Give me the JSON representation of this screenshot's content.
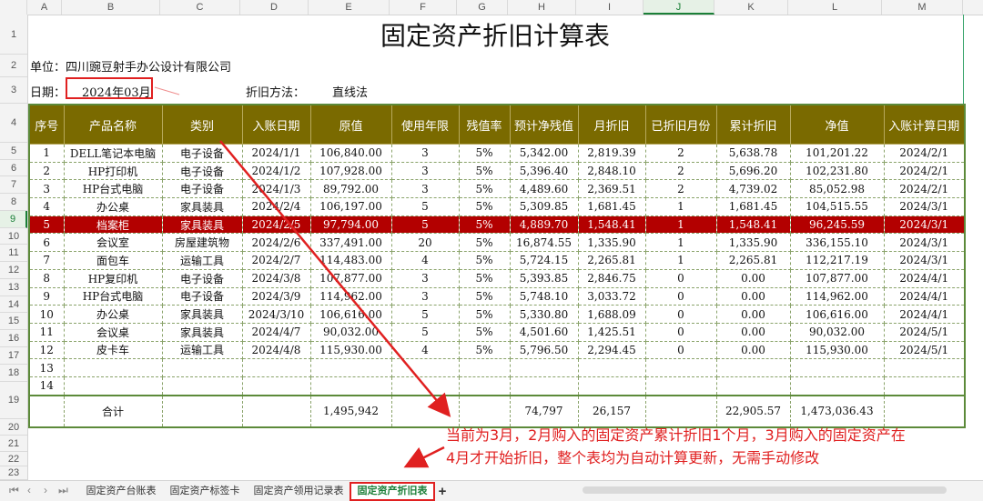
{
  "columns": [
    "A",
    "B",
    "C",
    "D",
    "E",
    "F",
    "G",
    "H",
    "I",
    "J",
    "K",
    "L",
    "M"
  ],
  "selected_column": "J",
  "row_numbers": [
    "1",
    "2",
    "3",
    "4",
    "5",
    "6",
    "7",
    "8",
    "9",
    "10",
    "11",
    "12",
    "13",
    "14",
    "15",
    "16",
    "17",
    "18",
    "19",
    "20",
    "21",
    "22",
    "23"
  ],
  "selected_row": "9",
  "title": "固定资产折旧计算表",
  "unit_label": "单位：四川豌豆射手办公设计有限公司",
  "date_label": "日期：",
  "date_value": "2024年03月",
  "method_label": "折旧方法：",
  "method_value": "直线法",
  "headers": [
    "序号",
    "产品名称",
    "类别",
    "入账日期",
    "原值",
    "使用年限",
    "残值率",
    "预计净残值",
    "月折旧",
    "已折旧月份",
    "累计折旧",
    "净值",
    "入账计算日期"
  ],
  "rows": [
    [
      "1",
      "DELL笔记本电脑",
      "电子设备",
      "2024/1/1",
      "106,840.00",
      "3",
      "5%",
      "5,342.00",
      "2,819.39",
      "2",
      "5,638.78",
      "101,201.22",
      "2024/2/1"
    ],
    [
      "2",
      "HP打印机",
      "电子设备",
      "2024/1/2",
      "107,928.00",
      "3",
      "5%",
      "5,396.40",
      "2,848.10",
      "2",
      "5,696.20",
      "102,231.80",
      "2024/2/1"
    ],
    [
      "3",
      "HP台式电脑",
      "电子设备",
      "2024/1/3",
      "89,792.00",
      "3",
      "5%",
      "4,489.60",
      "2,369.51",
      "2",
      "4,739.02",
      "85,052.98",
      "2024/2/1"
    ],
    [
      "4",
      "办公桌",
      "家具装具",
      "2024/2/4",
      "106,197.00",
      "5",
      "5%",
      "5,309.85",
      "1,681.45",
      "1",
      "1,681.45",
      "104,515.55",
      "2024/3/1"
    ],
    [
      "5",
      "档案柜",
      "家具装具",
      "2024/2/5",
      "97,794.00",
      "5",
      "5%",
      "4,889.70",
      "1,548.41",
      "1",
      "1,548.41",
      "96,245.59",
      "2024/3/1"
    ],
    [
      "6",
      "会议室",
      "房屋建筑物",
      "2024/2/6",
      "337,491.00",
      "20",
      "5%",
      "16,874.55",
      "1,335.90",
      "1",
      "1,335.90",
      "336,155.10",
      "2024/3/1"
    ],
    [
      "7",
      "面包车",
      "运输工具",
      "2024/2/7",
      "114,483.00",
      "4",
      "5%",
      "5,724.15",
      "2,265.81",
      "1",
      "2,265.81",
      "112,217.19",
      "2024/3/1"
    ],
    [
      "8",
      "HP复印机",
      "电子设备",
      "2024/3/8",
      "107,877.00",
      "3",
      "5%",
      "5,393.85",
      "2,846.75",
      "0",
      "0.00",
      "107,877.00",
      "2024/4/1"
    ],
    [
      "9",
      "HP台式电脑",
      "电子设备",
      "2024/3/9",
      "114,962.00",
      "3",
      "5%",
      "5,748.10",
      "3,033.72",
      "0",
      "0.00",
      "114,962.00",
      "2024/4/1"
    ],
    [
      "10",
      "办公桌",
      "家具装具",
      "2024/3/10",
      "106,616.00",
      "5",
      "5%",
      "5,330.80",
      "1,688.09",
      "0",
      "0.00",
      "106,616.00",
      "2024/4/1"
    ],
    [
      "11",
      "会议桌",
      "家具装具",
      "2024/4/7",
      "90,032.00",
      "5",
      "5%",
      "4,501.60",
      "1,425.51",
      "0",
      "0.00",
      "90,032.00",
      "2024/5/1"
    ],
    [
      "12",
      "皮卡车",
      "运输工具",
      "2024/4/8",
      "115,930.00",
      "4",
      "5%",
      "5,796.50",
      "2,294.45",
      "0",
      "0.00",
      "115,930.00",
      "2024/5/1"
    ],
    [
      "13",
      "",
      "",
      "",
      "",
      "",
      "",
      "",
      "",
      "",
      "",
      "",
      ""
    ],
    [
      "14",
      "",
      "",
      "",
      "",
      "",
      "",
      "",
      "",
      "",
      "",
      "",
      ""
    ]
  ],
  "selected_data_row": 4,
  "total": [
    "",
    "合计",
    "",
    "",
    "1,495,942",
    "",
    "",
    "74,797",
    "26,157",
    "",
    "22,905.57",
    "1,473,036.43",
    ""
  ],
  "annotation_line1": "当前为3月，2月购入的固定资产累计折旧1个月，3月购入的固定资产在",
  "annotation_line2": "4月才开始折旧，整个表均为自动计算更新，无需手动修改",
  "sheet_tabs": [
    "固定资产台账表",
    "固定资产标签卡",
    "固定资产领用记录表",
    "固定资产折旧表"
  ],
  "active_tab": 3,
  "add_tab": "+",
  "colors": {
    "header_bg": "#7a6a00",
    "selected_row_bg": "#b30000",
    "annotation": "#e02020",
    "accent": "#1a7f37"
  }
}
